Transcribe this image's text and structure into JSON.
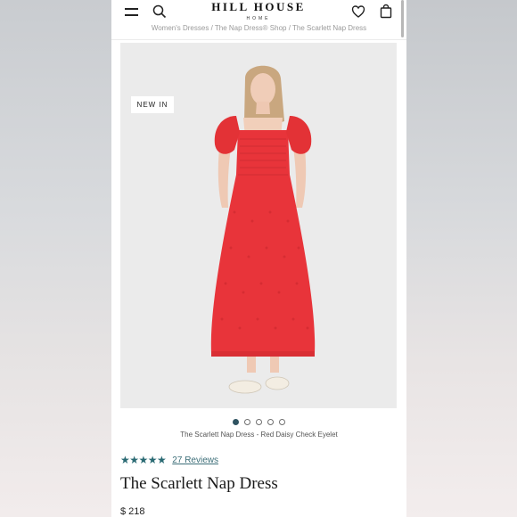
{
  "header": {
    "brand_main": "HILL HOUSE",
    "brand_sub": "HOME",
    "icons": [
      "menu-icon",
      "search-icon",
      "heart-icon",
      "bag-icon"
    ]
  },
  "breadcrumb": {
    "items": [
      "Women's Dresses",
      "The Nap Dress® Shop",
      "The Scarlett Nap Dress"
    ],
    "separator": "/"
  },
  "product_image": {
    "badge": "NEW IN",
    "carousel_count": 5,
    "carousel_active": 1,
    "caption": "The Scarlett Nap Dress - Red Daisy Check Eyelet"
  },
  "rating": {
    "stars": "★★★★★",
    "reviews_label": "27 Reviews"
  },
  "product": {
    "title": "The Scarlett Nap Dress",
    "price": "$ 218"
  },
  "colors": {
    "accent": "#2a6a73",
    "dress": "#e8343a",
    "image_bg": "#ebebeb"
  }
}
